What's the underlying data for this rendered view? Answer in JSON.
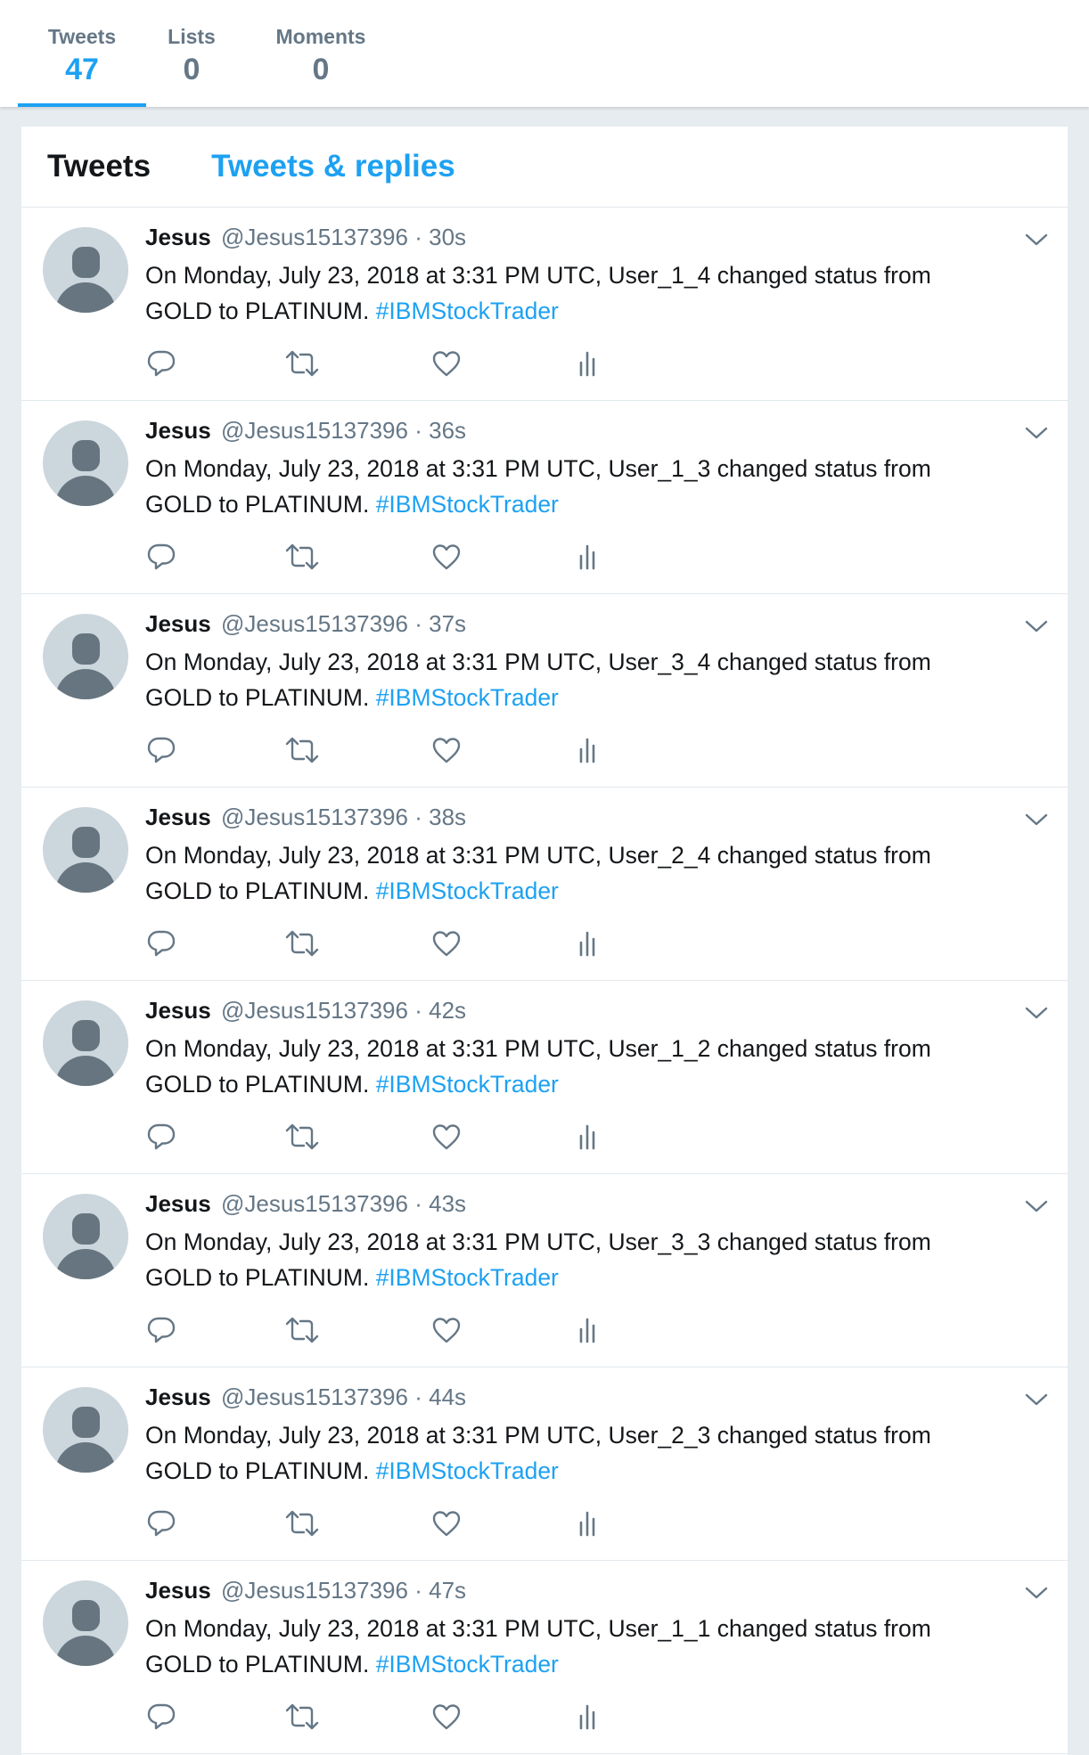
{
  "profile_nav": {
    "stats": [
      {
        "label": "Tweets",
        "value": "47",
        "active": true
      },
      {
        "label": "Lists",
        "value": "0",
        "active": false
      },
      {
        "label": "Moments",
        "value": "0",
        "active": false
      }
    ]
  },
  "timeline": {
    "tabs": [
      {
        "label": "Tweets",
        "active": true
      },
      {
        "label": "Tweets & replies",
        "active": false
      }
    ],
    "tweets": [
      {
        "name": "Jesus",
        "handle": "@Jesus15137396",
        "separator": "·",
        "time": "30s",
        "text": "On Monday, July 23, 2018 at 3:31 PM UTC, User_1_4 changed status from GOLD to PLATINUM.",
        "hashtag": "#IBMStockTrader"
      },
      {
        "name": "Jesus",
        "handle": "@Jesus15137396",
        "separator": "·",
        "time": "36s",
        "text": "On Monday, July 23, 2018 at 3:31 PM UTC, User_1_3 changed status from GOLD to PLATINUM.",
        "hashtag": "#IBMStockTrader"
      },
      {
        "name": "Jesus",
        "handle": "@Jesus15137396",
        "separator": "·",
        "time": "37s",
        "text": "On Monday, July 23, 2018 at 3:31 PM UTC, User_3_4 changed status from GOLD to PLATINUM.",
        "hashtag": "#IBMStockTrader"
      },
      {
        "name": "Jesus",
        "handle": "@Jesus15137396",
        "separator": "·",
        "time": "38s",
        "text": "On Monday, July 23, 2018 at 3:31 PM UTC, User_2_4 changed status from GOLD to PLATINUM.",
        "hashtag": "#IBMStockTrader"
      },
      {
        "name": "Jesus",
        "handle": "@Jesus15137396",
        "separator": "·",
        "time": "42s",
        "text": "On Monday, July 23, 2018 at 3:31 PM UTC, User_1_2 changed status from GOLD to PLATINUM.",
        "hashtag": "#IBMStockTrader"
      },
      {
        "name": "Jesus",
        "handle": "@Jesus15137396",
        "separator": "·",
        "time": "43s",
        "text": "On Monday, July 23, 2018 at 3:31 PM UTC, User_3_3 changed status from GOLD to PLATINUM.",
        "hashtag": "#IBMStockTrader"
      },
      {
        "name": "Jesus",
        "handle": "@Jesus15137396",
        "separator": "·",
        "time": "44s",
        "text": "On Monday, July 23, 2018 at 3:31 PM UTC, User_2_3 changed status from GOLD to PLATINUM.",
        "hashtag": "#IBMStockTrader"
      },
      {
        "name": "Jesus",
        "handle": "@Jesus15137396",
        "separator": "·",
        "time": "47s",
        "text": "On Monday, July 23, 2018 at 3:31 PM UTC, User_1_1 changed status from GOLD to PLATINUM.",
        "hashtag": "#IBMStockTrader"
      }
    ]
  },
  "icons": {
    "caret": "chevron-down-icon",
    "reply": "reply-icon",
    "retweet": "retweet-icon",
    "like": "heart-icon",
    "analytics": "analytics-icon",
    "avatar": "default-avatar-icon"
  },
  "colors": {
    "accent": "#1da1f2",
    "muted": "#657786",
    "text": "#14171a",
    "background": "#e6ecf0",
    "avatar_bg": "#ccd6dd",
    "avatar_fg": "#66757f"
  }
}
